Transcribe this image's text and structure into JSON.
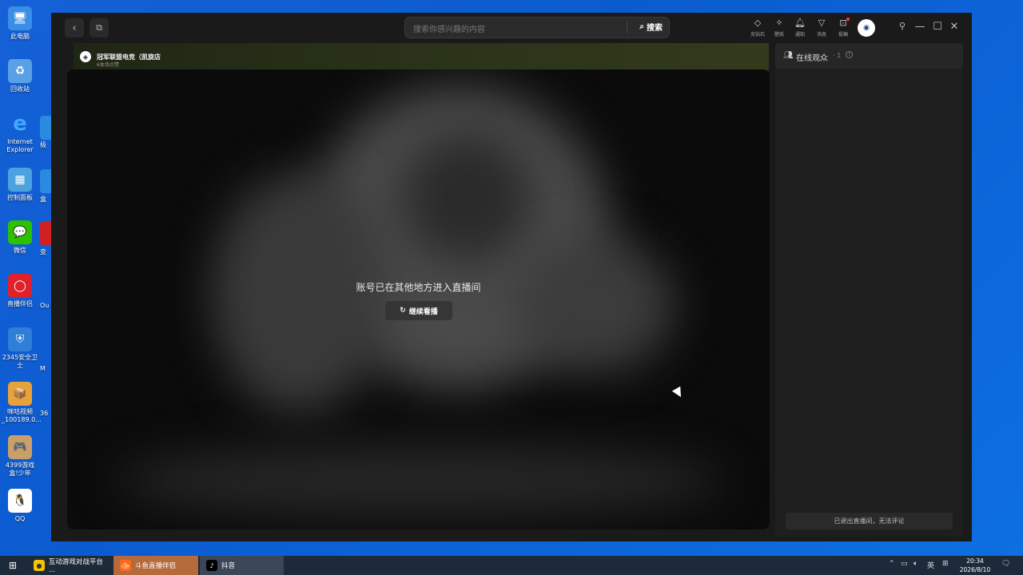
{
  "desktop": {
    "icons": [
      {
        "label": "此电脑",
        "icon": "computer-icon",
        "color": "#3a8ee6"
      },
      {
        "label": "回收站",
        "icon": "recycle-bin-icon",
        "color": "#5aa0e6"
      },
      {
        "label": "Internet Explorer",
        "icon": "ie-icon",
        "color": "#1e90ff"
      },
      {
        "label": "控制面板",
        "icon": "control-panel-icon",
        "color": "#4aa3df"
      },
      {
        "label": "微信",
        "icon": "wechat-icon",
        "color": "#2dc100"
      },
      {
        "label": "直播伴侣",
        "icon": "live-companion-icon",
        "color": "#e0202a"
      },
      {
        "label": "2345安全卫士",
        "icon": "shield-icon",
        "color": "#2f7fd8"
      },
      {
        "label": "咪咕视频_100189.0...",
        "icon": "package-icon",
        "color": "#e8a23a"
      },
      {
        "label": "4399游戏盒!少年",
        "icon": "game-box-icon",
        "color": "#caa06a"
      },
      {
        "label": "QQ",
        "icon": "qq-icon",
        "color": "#ffffff"
      }
    ],
    "partial_labels": [
      "极",
      "盒",
      "变",
      "Ou",
      "M",
      "36"
    ]
  },
  "app": {
    "search": {
      "placeholder": "搜索你感兴趣的内容",
      "button": "搜索"
    },
    "toolbar": [
      {
        "icon": "diamond-icon",
        "label": "充钻石"
      },
      {
        "icon": "wallpaper-icon",
        "label": "壁纸"
      },
      {
        "icon": "bell-icon",
        "label": "通知"
      },
      {
        "icon": "message-icon",
        "label": "消息"
      },
      {
        "icon": "submit-icon",
        "label": "投稿"
      }
    ],
    "stream": {
      "name": "冠军联盟电竞（凯旋店",
      "sub": "6本场点赞",
      "message": "账号已在其他地方进入直播间",
      "continue_button": "继续看播"
    },
    "panel": {
      "title": "在线观众",
      "count": "· 1",
      "footer": "已退出直播间，无法评论"
    }
  },
  "taskbar": {
    "items": [
      {
        "label": "互动游戏对战平台 ...",
        "icon": "game-platform-icon",
        "color": "#f5c400"
      },
      {
        "label": "斗鱼直播伴侣",
        "icon": "douyu-icon",
        "color": "#ff6a1a"
      },
      {
        "label": "抖音",
        "icon": "douyin-icon",
        "color": "#000000"
      }
    ],
    "ime": "英",
    "time": "20:34",
    "date": "2026/8/10"
  }
}
